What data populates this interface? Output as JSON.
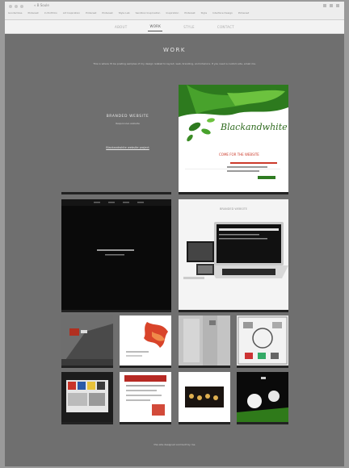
{
  "browser": {
    "window_title": "« B Soule",
    "bookmarks": [
      "Goodsmiles",
      "Pinterest",
      "In Portfolio",
      "Art Inspiration",
      "Pinterest",
      "Pinterest",
      "Style Lab",
      "Sandbox Insprnation",
      "Inspiration",
      "Pinterest",
      "Style",
      "Interface Design",
      "Pinterest"
    ]
  },
  "nav": {
    "items": [
      "ABOUT",
      "WORK",
      "STYLE",
      "CONTACT"
    ]
  },
  "page": {
    "title": "WORK",
    "intro": "This is where I'll be posting samples of my design related to layout, web, branding, and interiors. If you need a custom site, email me.",
    "left_block": {
      "title": "BRANDED WEBSITE",
      "subtitle": "Responsive website",
      "link": "Blackandwhite website project"
    },
    "footer": "this site designed and built by me"
  },
  "tiles": {
    "blackandwhite": {
      "logo": "Blackandwhite",
      "tagline": "COME FOR THE WEBSITE"
    },
    "laptop": {
      "label": "BRANDED WEBSITE"
    }
  }
}
